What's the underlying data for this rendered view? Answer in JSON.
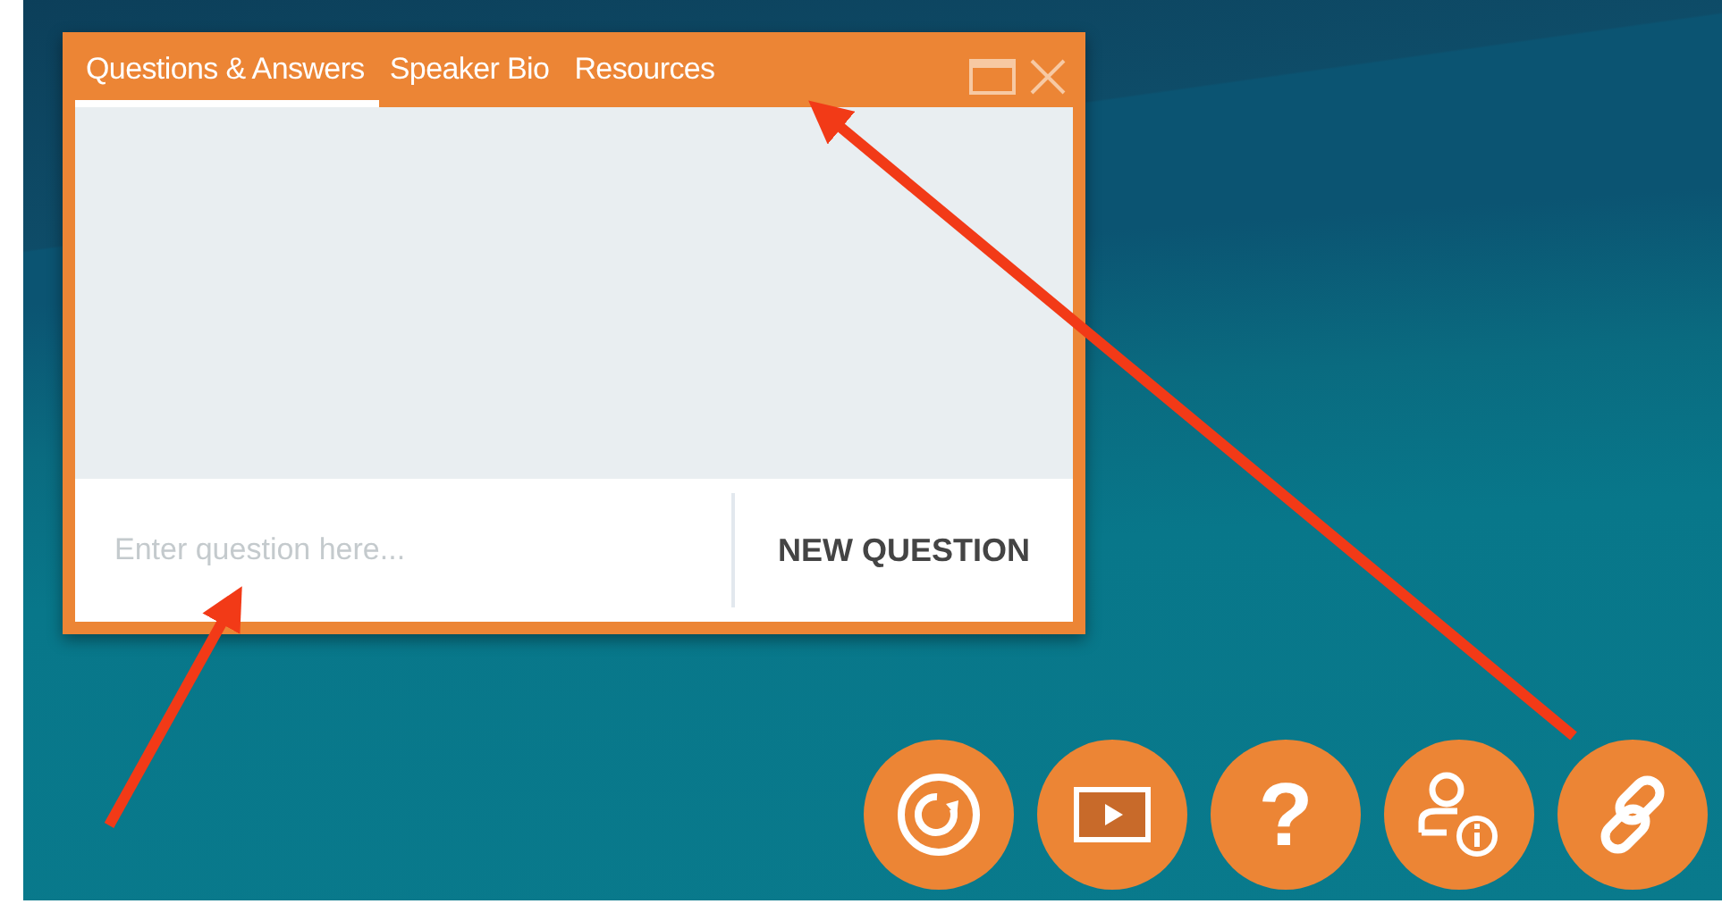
{
  "panel": {
    "tabs": [
      {
        "label": "Questions & Answers",
        "selected": true
      },
      {
        "label": "Speaker Bio",
        "selected": false
      },
      {
        "label": "Resources",
        "selected": false
      }
    ],
    "question_field": {
      "placeholder": "Enter question here..."
    },
    "new_question_button": "NEW QUESTION"
  },
  "dock_buttons": [
    {
      "kind": "refresh"
    },
    {
      "kind": "video"
    },
    {
      "kind": "help",
      "glyph": "?"
    },
    {
      "kind": "speaker"
    },
    {
      "kind": "link"
    }
  ]
}
